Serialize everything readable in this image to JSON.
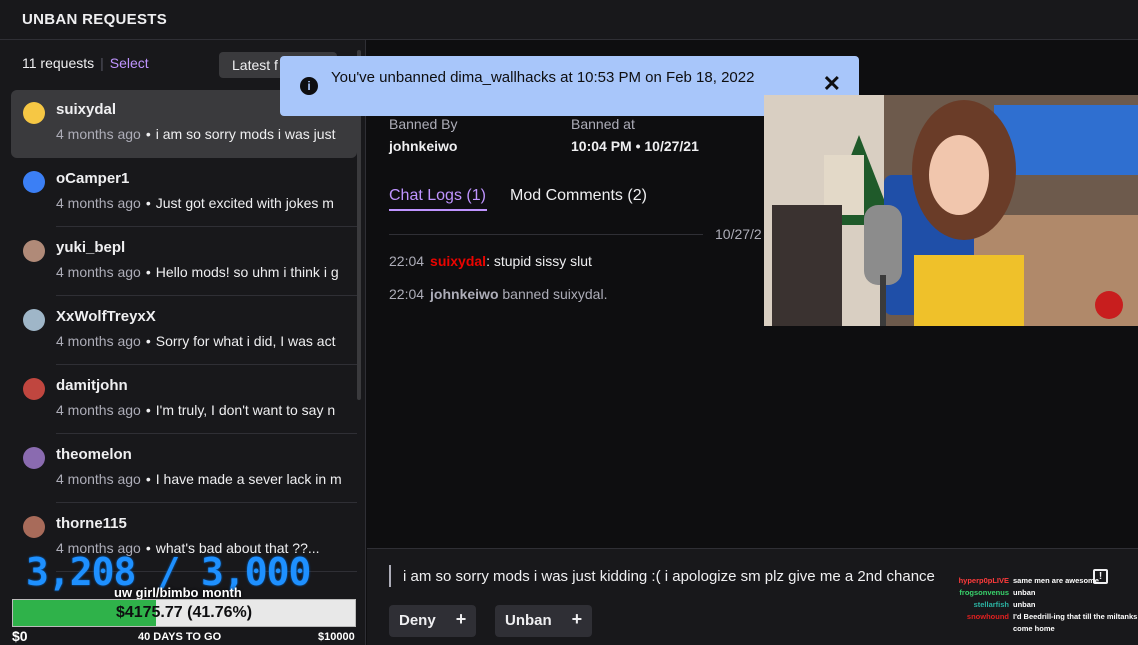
{
  "header": {
    "title": "UNBAN REQUESTS"
  },
  "sidebar": {
    "count_label": "11 requests",
    "select_label": "Select",
    "sort_label": "Latest f",
    "requests": [
      {
        "user": "suixydal",
        "time": "4 months ago",
        "message": "i am so sorry mods i was just",
        "avatar_color": "#f6c744"
      },
      {
        "user": "oCamper1",
        "time": "4 months ago",
        "message": "Just got excited with jokes m",
        "avatar_color": "#3b7ff5"
      },
      {
        "user": "yuki_bepl",
        "time": "4 months ago",
        "message": "Hello mods! so uhm i think i g",
        "avatar_color": "#b08a78"
      },
      {
        "user": "XxWolfTreyxX",
        "time": "4 months ago",
        "message": "Sorry for what i did, I was act",
        "avatar_color": "#9fb6c8"
      },
      {
        "user": "damitjohn",
        "time": "4 months ago",
        "message": "I'm truly, I don't want to say n",
        "avatar_color": "#c0463f"
      },
      {
        "user": "theomelon",
        "time": "4 months ago",
        "message": "I have made a sever lack in m",
        "avatar_color": "#8a6bb0"
      },
      {
        "user": "thorne115",
        "time": "4 months ago",
        "message": "what's bad about that ??...",
        "avatar_color": "#a86b5a"
      }
    ]
  },
  "detail": {
    "banned_by_label": "Banned By",
    "banned_by": "johnkeiwo",
    "banned_at_label": "Banned at",
    "banned_at": "10:04 PM • 10/27/21",
    "tabs": [
      {
        "label": "Chat Logs (1)"
      },
      {
        "label": "Mod Comments (2)"
      }
    ],
    "log_date": "10/27/2",
    "logs": [
      {
        "time": "22:04",
        "user": "suixydal",
        "text": ": stupid sissy slut"
      },
      {
        "time": "22:04",
        "user": "johnkeiwo",
        "text": " banned suixydal."
      }
    ],
    "reply_text": "i am so sorry mods i was just kidding :( i apologize sm plz give me a 2nd chance",
    "deny_label": "Deny",
    "unban_label": "Unban",
    "plus_glyph": "+"
  },
  "toast": {
    "message": "You've unbanned dima_wallhacks at 10:53 PM on Feb 18, 2022",
    "info_glyph": "i",
    "close_glyph": "✕",
    "bg_color": "#a8c6fa"
  },
  "overlay": {
    "count": "3,208 / 3,000",
    "sub_text": "uw girl/bimbo month",
    "goal_text": "$4175.77 (41.76%)",
    "goal_fraction": 0.4176,
    "goal_start": "$0",
    "goal_days": "40 DAYS TO GO",
    "goal_end": "$10000"
  },
  "mini_chat": [
    {
      "name": "hyperp0pLIVE",
      "text": "same men are awesome",
      "color": "#ff3b3b"
    },
    {
      "name": "frogsonvenus",
      "text": "unban",
      "color": "#38d36b"
    },
    {
      "name": "stellarfish",
      "text": "unban",
      "color": "#2bb3a3"
    },
    {
      "name": "snowhound",
      "text": "I'd Beedrill-ing that till the miltanks",
      "color": "#e02020"
    },
    {
      "name": "",
      "text": "come home",
      "color": "#ffffff"
    }
  ],
  "colors": {
    "accent": "#bf94ff",
    "bg": "#0e0e10",
    "panel": "#18181b"
  }
}
